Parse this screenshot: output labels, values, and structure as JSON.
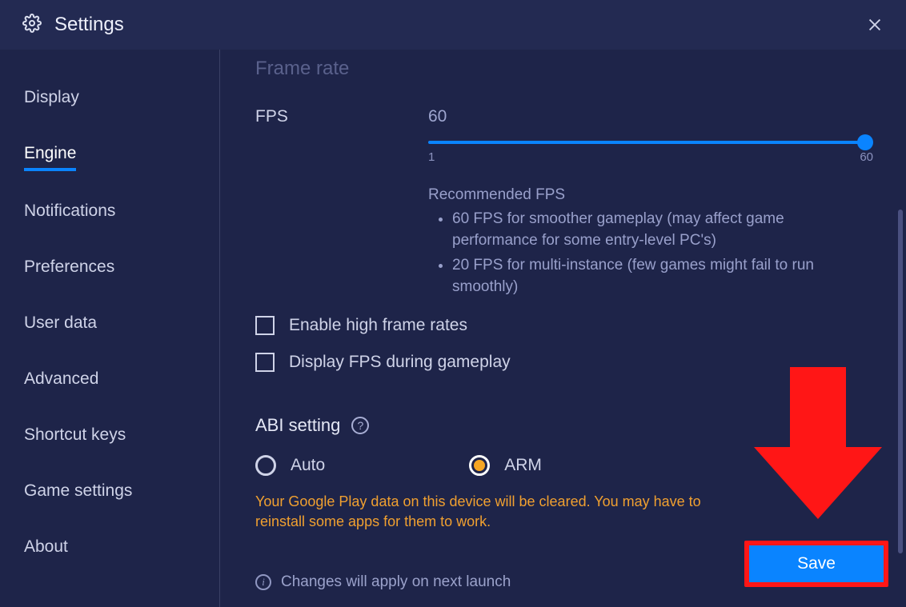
{
  "title": "Settings",
  "sidebar": {
    "items": [
      {
        "label": "Display"
      },
      {
        "label": "Engine"
      },
      {
        "label": "Notifications"
      },
      {
        "label": "Preferences"
      },
      {
        "label": "User data"
      },
      {
        "label": "Advanced"
      },
      {
        "label": "Shortcut keys"
      },
      {
        "label": "Game settings"
      },
      {
        "label": "About"
      }
    ],
    "active_index": 1
  },
  "engine": {
    "frame_rate_heading": "Frame rate",
    "fps_label": "FPS",
    "fps_value": "60",
    "slider": {
      "min": "1",
      "max": "60",
      "current": 60
    },
    "recommended_heading": "Recommended FPS",
    "recommended": [
      "60 FPS for smoother gameplay (may affect game performance for some entry-level PC's)",
      "20 FPS for multi-instance (few games might fail to run smoothly)"
    ],
    "checkboxes": {
      "high_fps": "Enable high frame rates",
      "display_fps": "Display FPS during gameplay"
    },
    "abi": {
      "heading": "ABI setting",
      "options": {
        "auto": "Auto",
        "arm": "ARM"
      },
      "selected": "arm",
      "warning": "Your Google Play data on this device will be cleared. You may have to reinstall some apps for them to work."
    },
    "footer_note": "Changes will apply on next launch",
    "save_label": "Save"
  }
}
